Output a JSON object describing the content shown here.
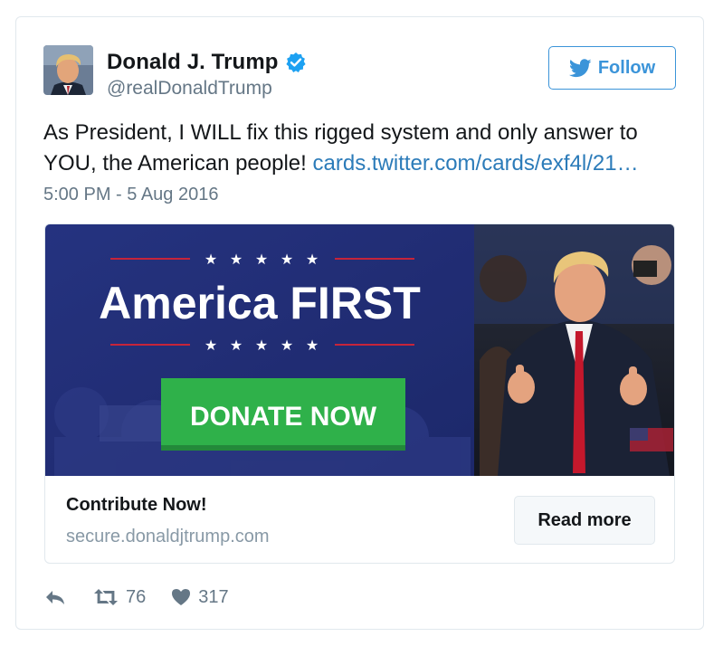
{
  "author": {
    "name": "Donald J. Trump",
    "handle": "@realDonaldTrump",
    "verified": true
  },
  "follow_label": "Follow",
  "tweet": {
    "text": "As President, I WILL fix this rigged system and only answer to YOU, the American people! ",
    "link": "cards.twitter.com/cards/exf4l/21…",
    "timestamp": "5:00 PM - 5 Aug 2016"
  },
  "card": {
    "banner_headline": "America FIRST",
    "banner_button": "DONATE NOW",
    "title": "Contribute Now!",
    "url": "secure.donaldjtrump.com",
    "cta_label": "Read more"
  },
  "stats": {
    "retweets": "76",
    "likes": "317"
  },
  "colors": {
    "link": "#2b7bb9",
    "follow": "#3b94d9",
    "verified": "#1da1f2",
    "banner_bg": "#1f2a6d",
    "donate_green": "#2fb14a",
    "muted": "#657786"
  },
  "icons": [
    "twitter-bird-icon",
    "verified-badge-icon",
    "reply-icon",
    "retweet-icon",
    "heart-icon"
  ]
}
